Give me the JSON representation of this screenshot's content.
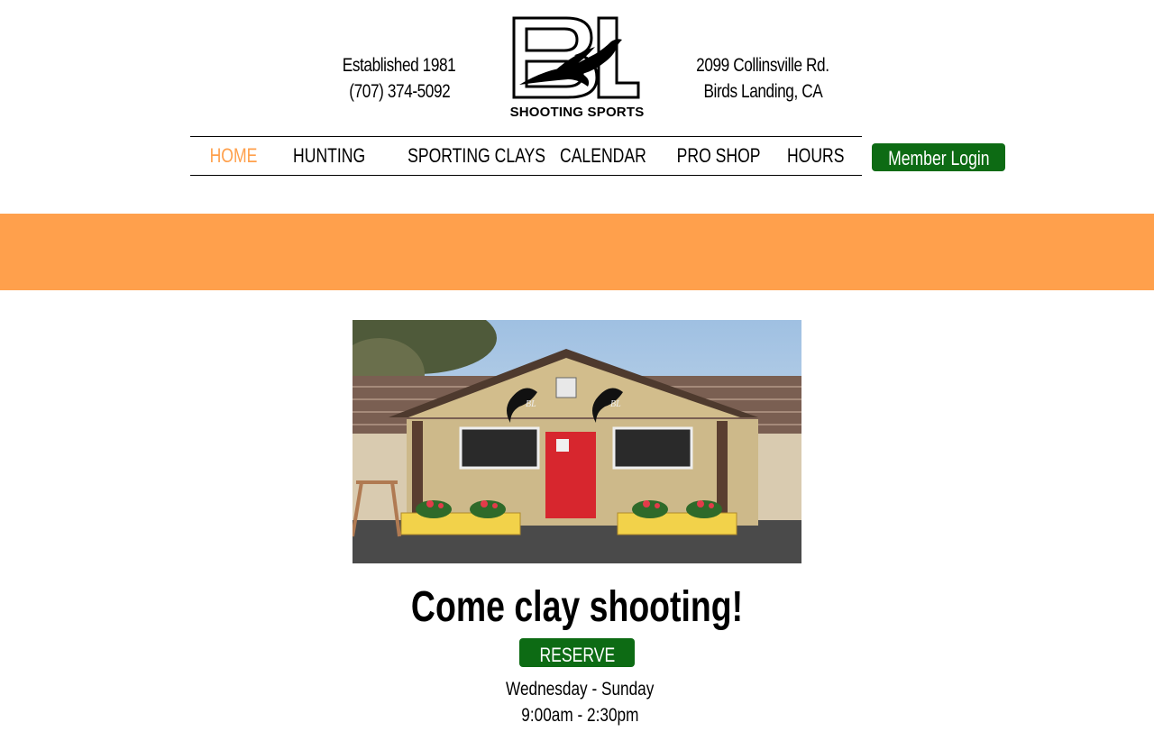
{
  "header": {
    "established": "Established 1981",
    "phone": "(707) 374-5092",
    "address_line1": "2099 Collinsville Rd.",
    "address_line2": "Birds Landing, CA",
    "logo": {
      "letters": "BL",
      "tagline": "SHOOTING SPORTS",
      "icon": "pheasant-icon"
    }
  },
  "nav": {
    "items": [
      {
        "label": "HOME",
        "active": true
      },
      {
        "label": "HUNTING",
        "active": false
      },
      {
        "label": "SPORTING CLAYS",
        "active": false
      },
      {
        "label": "CALENDAR",
        "active": false
      },
      {
        "label": "PRO SHOP",
        "active": false
      },
      {
        "label": "HOURS",
        "active": false
      }
    ],
    "login_label": "Member Login"
  },
  "main": {
    "headline": "Come clay shooting!",
    "reserve_label": "RESERVE",
    "days": "Wednesday - Sunday",
    "time": "9:00am - 2:30pm",
    "photo": {
      "sign_letters": "BL"
    }
  },
  "colors": {
    "accent_orange": "#ffa04c",
    "button_green": "#0d6b14",
    "text": "#000000"
  }
}
